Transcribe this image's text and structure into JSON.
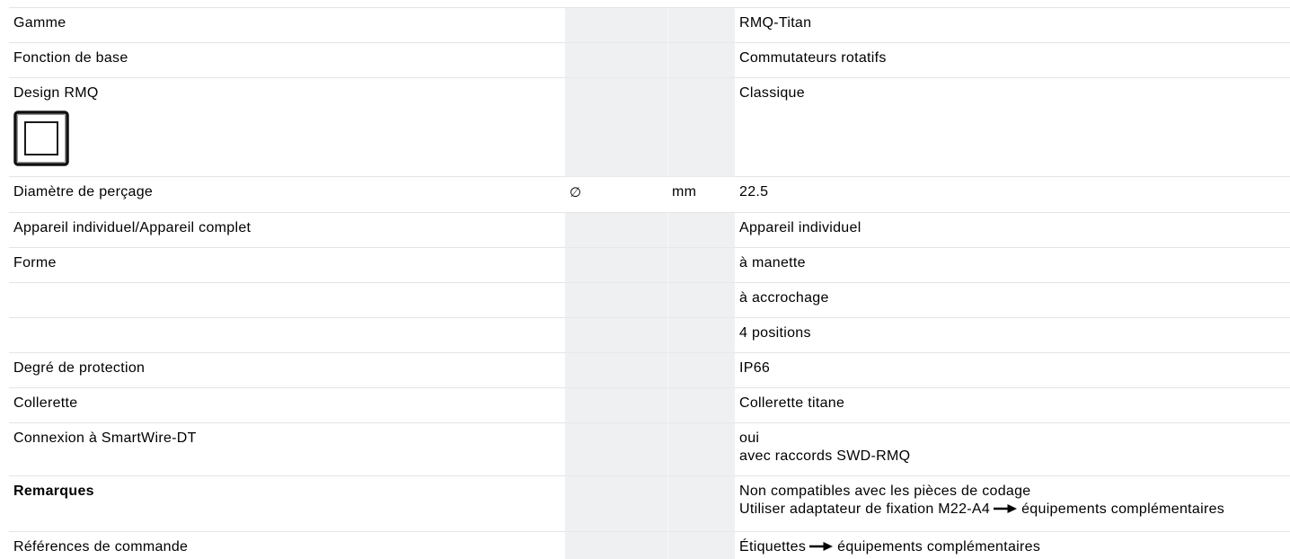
{
  "spec_table": {
    "rows": [
      {
        "label": "Gamme",
        "value": "RMQ-Titan"
      },
      {
        "label": "Fonction de base",
        "value": "Commutateurs rotatifs"
      },
      {
        "label": "Design RMQ",
        "icon": "classic-square-design-icon",
        "value": "Classique"
      },
      {
        "label": "Diamètre de perçage",
        "symbol": "∅",
        "unit": "mm",
        "value": "22.5"
      },
      {
        "label": "Appareil individuel/Appareil complet",
        "value": "Appareil individuel"
      },
      {
        "label": "Forme",
        "value": "à manette"
      },
      {
        "value": "à accrochage"
      },
      {
        "value": "4 positions"
      },
      {
        "label": "Degré de protection",
        "value": "IP66"
      },
      {
        "label": "Collerette",
        "value": "Collerette titane"
      },
      {
        "label": "Connexion à SmartWire-DT",
        "value_lines": [
          "oui",
          "avec raccords SWD-RMQ"
        ]
      },
      {
        "label": "Remarques",
        "value_lines": [
          "Non compatibles avec les pièces de codage",
          {
            "before": "Utiliser adaptateur de fixation M22-A4",
            "icon": "arrow-right-icon",
            "after": "équipements complémentaires"
          }
        ]
      },
      {
        "label": "Références de commande",
        "value_lines": [
          {
            "before": "Étiquettes",
            "icon": "arrow-right-icon",
            "after": "équipements complémentaires"
          }
        ]
      }
    ]
  },
  "colors": {
    "empty_cell_bg": "#eef0f2",
    "row_border": "#e4e4e4",
    "text": "#000000"
  }
}
